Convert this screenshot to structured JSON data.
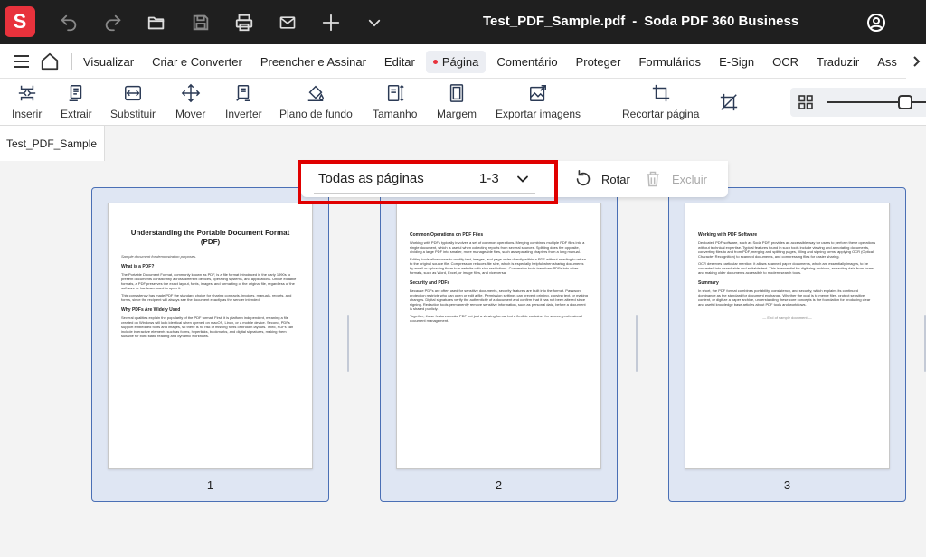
{
  "titlebar": {
    "logo": "S",
    "file_name": "Test_PDF_Sample.pdf",
    "separator": "-",
    "app_name": "Soda PDF 360 Business"
  },
  "menu": {
    "items": [
      "Visualizar",
      "Criar e Converter",
      "Preencher e Assinar",
      "Editar",
      "Página",
      "Comentário",
      "Proteger",
      "Formulários",
      "E-Sign",
      "OCR",
      "Traduzir",
      "Ass"
    ],
    "active": "Página"
  },
  "toolbar": {
    "tools": [
      "Inserir",
      "Extrair",
      "Substituir",
      "Mover",
      "Inverter",
      "Plano de fundo",
      "Tamanho",
      "Margem",
      "Exportar imagens",
      "Recortar página"
    ]
  },
  "tab": {
    "label": "Test_PDF_Sample"
  },
  "page_toolbar": {
    "select_label": "Todas as páginas",
    "select_range": "1-3",
    "rotate_label": "Rotar",
    "delete_label": "Excluir"
  },
  "colors": {
    "accent": "#e8323c",
    "selection_border": "#4a6fb5",
    "highlight": "#e00000"
  },
  "pages": [
    {
      "number": "1",
      "title": "Understanding the Portable Document Format (PDF)",
      "subtitle": "Sample document for demonstration purposes.",
      "h_a": "What is a PDF?",
      "p_a": "The Portable Document Format, commonly known as PDF, is a file format introduced in the early 1990s to present documents consistently across different devices, operating systems, and applications. Unlike editable formats, a PDF preserves the exact layout, fonts, images, and formatting of the original file, regardless of the software or hardware used to open it.",
      "p_b": "This consistency has made PDF the standard choice for sharing contracts, invoices, manuals, reports, and forms, since the recipient will always see the document exactly as the sender intended.",
      "h_b": "Why PDFs Are Widely Used",
      "p_c": "Several qualities explain the popularity of the PDF format. First, it is platform independent, meaning a file created on Windows will look identical when opened on macOS, Linux, or a mobile device. Second, PDFs support embedded fonts and images, so there is no risk of missing fonts or broken layouts. Third, PDFs can include interactive elements such as forms, hyperlinks, bookmarks, and digital signatures, making them suitable for both static reading and dynamic workflows."
    },
    {
      "number": "2",
      "h_a": "Common Operations on PDF Files",
      "p_a": "Working with PDFs typically involves a set of common operations. Merging combines multiple PDF files into a single document, which is useful when collecting reports from several sources. Splitting does the opposite, dividing a large PDF into smaller, more manageable files, such as separating chapters from a long manual.",
      "p_b": "Editing tools allow users to modify text, images, and page order directly within a PDF without needing to return to the original source file. Compression reduces file size, which is especially helpful when sharing documents by email or uploading them to a website with size restrictions. Conversion tools transform PDFs into other formats, such as Word, Excel, or image files, and vice versa.",
      "h_b": "Security and PDFs",
      "p_c": "Because PDFs are often used for sensitive documents, security features are built into the format. Password protection restricts who can open or edit a file. Permission settings can prevent printing, copying text, or making changes. Digital signatures verify the authenticity of a document and confirm that it has not been altered since signing. Redaction tools permanently remove sensitive information, such as personal data, before a document is shared publicly.",
      "p_d": "Together, these features make PDF not just a viewing format but a flexible container for secure, professional document management."
    },
    {
      "number": "3",
      "h_a": "Working with PDF Software",
      "p_a": "Dedicated PDF software, such as Soda PDF, provides an accessible way for users to perform these operations without technical expertise. Typical features found in such tools include viewing and annotating documents, converting files to and from PDF, merging and splitting pages, filling and signing forms, applying OCR (Optical Character Recognition) to scanned documents, and compressing files for easier sharing.",
      "p_b": "OCR deserves particular mention: it allows scanned paper documents, which are essentially images, to be converted into searchable and editable text. This is essential for digitizing archives, extracting data from forms, and making older documents accessible to modern search tools.",
      "h_b": "Summary",
      "p_c": "In short, the PDF format combines portability, consistency, and security, which explains its continued dominance as the standard for document exchange. Whether the goal is to merge files, protect sensitive content, or digitize a paper archive, understanding these core concepts is the foundation for producing clear and useful knowledge base articles about PDF tools and workflows.",
      "end": "— End of sample document —"
    }
  ]
}
